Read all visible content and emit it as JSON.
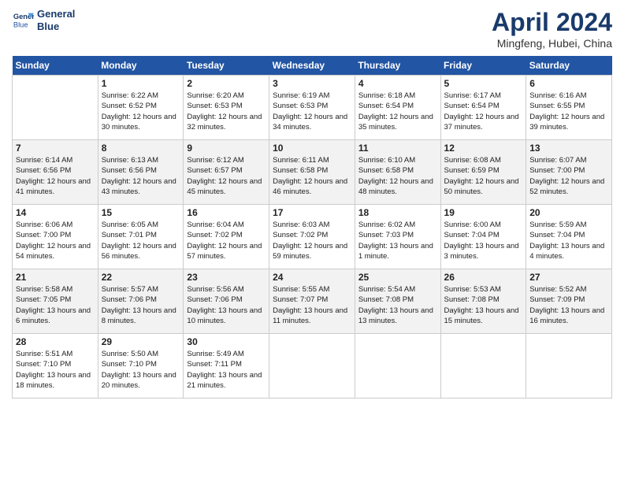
{
  "header": {
    "logo_line1": "General",
    "logo_line2": "Blue",
    "title": "April 2024",
    "location": "Mingfeng, Hubei, China"
  },
  "columns": [
    "Sunday",
    "Monday",
    "Tuesday",
    "Wednesday",
    "Thursday",
    "Friday",
    "Saturday"
  ],
  "weeks": [
    [
      {
        "day": "",
        "sunrise": "",
        "sunset": "",
        "daylight": ""
      },
      {
        "day": "1",
        "sunrise": "Sunrise: 6:22 AM",
        "sunset": "Sunset: 6:52 PM",
        "daylight": "Daylight: 12 hours and 30 minutes."
      },
      {
        "day": "2",
        "sunrise": "Sunrise: 6:20 AM",
        "sunset": "Sunset: 6:53 PM",
        "daylight": "Daylight: 12 hours and 32 minutes."
      },
      {
        "day": "3",
        "sunrise": "Sunrise: 6:19 AM",
        "sunset": "Sunset: 6:53 PM",
        "daylight": "Daylight: 12 hours and 34 minutes."
      },
      {
        "day": "4",
        "sunrise": "Sunrise: 6:18 AM",
        "sunset": "Sunset: 6:54 PM",
        "daylight": "Daylight: 12 hours and 35 minutes."
      },
      {
        "day": "5",
        "sunrise": "Sunrise: 6:17 AM",
        "sunset": "Sunset: 6:54 PM",
        "daylight": "Daylight: 12 hours and 37 minutes."
      },
      {
        "day": "6",
        "sunrise": "Sunrise: 6:16 AM",
        "sunset": "Sunset: 6:55 PM",
        "daylight": "Daylight: 12 hours and 39 minutes."
      }
    ],
    [
      {
        "day": "7",
        "sunrise": "Sunrise: 6:14 AM",
        "sunset": "Sunset: 6:56 PM",
        "daylight": "Daylight: 12 hours and 41 minutes."
      },
      {
        "day": "8",
        "sunrise": "Sunrise: 6:13 AM",
        "sunset": "Sunset: 6:56 PM",
        "daylight": "Daylight: 12 hours and 43 minutes."
      },
      {
        "day": "9",
        "sunrise": "Sunrise: 6:12 AM",
        "sunset": "Sunset: 6:57 PM",
        "daylight": "Daylight: 12 hours and 45 minutes."
      },
      {
        "day": "10",
        "sunrise": "Sunrise: 6:11 AM",
        "sunset": "Sunset: 6:58 PM",
        "daylight": "Daylight: 12 hours and 46 minutes."
      },
      {
        "day": "11",
        "sunrise": "Sunrise: 6:10 AM",
        "sunset": "Sunset: 6:58 PM",
        "daylight": "Daylight: 12 hours and 48 minutes."
      },
      {
        "day": "12",
        "sunrise": "Sunrise: 6:08 AM",
        "sunset": "Sunset: 6:59 PM",
        "daylight": "Daylight: 12 hours and 50 minutes."
      },
      {
        "day": "13",
        "sunrise": "Sunrise: 6:07 AM",
        "sunset": "Sunset: 7:00 PM",
        "daylight": "Daylight: 12 hours and 52 minutes."
      }
    ],
    [
      {
        "day": "14",
        "sunrise": "Sunrise: 6:06 AM",
        "sunset": "Sunset: 7:00 PM",
        "daylight": "Daylight: 12 hours and 54 minutes."
      },
      {
        "day": "15",
        "sunrise": "Sunrise: 6:05 AM",
        "sunset": "Sunset: 7:01 PM",
        "daylight": "Daylight: 12 hours and 56 minutes."
      },
      {
        "day": "16",
        "sunrise": "Sunrise: 6:04 AM",
        "sunset": "Sunset: 7:02 PM",
        "daylight": "Daylight: 12 hours and 57 minutes."
      },
      {
        "day": "17",
        "sunrise": "Sunrise: 6:03 AM",
        "sunset": "Sunset: 7:02 PM",
        "daylight": "Daylight: 12 hours and 59 minutes."
      },
      {
        "day": "18",
        "sunrise": "Sunrise: 6:02 AM",
        "sunset": "Sunset: 7:03 PM",
        "daylight": "Daylight: 13 hours and 1 minute."
      },
      {
        "day": "19",
        "sunrise": "Sunrise: 6:00 AM",
        "sunset": "Sunset: 7:04 PM",
        "daylight": "Daylight: 13 hours and 3 minutes."
      },
      {
        "day": "20",
        "sunrise": "Sunrise: 5:59 AM",
        "sunset": "Sunset: 7:04 PM",
        "daylight": "Daylight: 13 hours and 4 minutes."
      }
    ],
    [
      {
        "day": "21",
        "sunrise": "Sunrise: 5:58 AM",
        "sunset": "Sunset: 7:05 PM",
        "daylight": "Daylight: 13 hours and 6 minutes."
      },
      {
        "day": "22",
        "sunrise": "Sunrise: 5:57 AM",
        "sunset": "Sunset: 7:06 PM",
        "daylight": "Daylight: 13 hours and 8 minutes."
      },
      {
        "day": "23",
        "sunrise": "Sunrise: 5:56 AM",
        "sunset": "Sunset: 7:06 PM",
        "daylight": "Daylight: 13 hours and 10 minutes."
      },
      {
        "day": "24",
        "sunrise": "Sunrise: 5:55 AM",
        "sunset": "Sunset: 7:07 PM",
        "daylight": "Daylight: 13 hours and 11 minutes."
      },
      {
        "day": "25",
        "sunrise": "Sunrise: 5:54 AM",
        "sunset": "Sunset: 7:08 PM",
        "daylight": "Daylight: 13 hours and 13 minutes."
      },
      {
        "day": "26",
        "sunrise": "Sunrise: 5:53 AM",
        "sunset": "Sunset: 7:08 PM",
        "daylight": "Daylight: 13 hours and 15 minutes."
      },
      {
        "day": "27",
        "sunrise": "Sunrise: 5:52 AM",
        "sunset": "Sunset: 7:09 PM",
        "daylight": "Daylight: 13 hours and 16 minutes."
      }
    ],
    [
      {
        "day": "28",
        "sunrise": "Sunrise: 5:51 AM",
        "sunset": "Sunset: 7:10 PM",
        "daylight": "Daylight: 13 hours and 18 minutes."
      },
      {
        "day": "29",
        "sunrise": "Sunrise: 5:50 AM",
        "sunset": "Sunset: 7:10 PM",
        "daylight": "Daylight: 13 hours and 20 minutes."
      },
      {
        "day": "30",
        "sunrise": "Sunrise: 5:49 AM",
        "sunset": "Sunset: 7:11 PM",
        "daylight": "Daylight: 13 hours and 21 minutes."
      },
      {
        "day": "",
        "sunrise": "",
        "sunset": "",
        "daylight": ""
      },
      {
        "day": "",
        "sunrise": "",
        "sunset": "",
        "daylight": ""
      },
      {
        "day": "",
        "sunrise": "",
        "sunset": "",
        "daylight": ""
      },
      {
        "day": "",
        "sunrise": "",
        "sunset": "",
        "daylight": ""
      }
    ]
  ]
}
